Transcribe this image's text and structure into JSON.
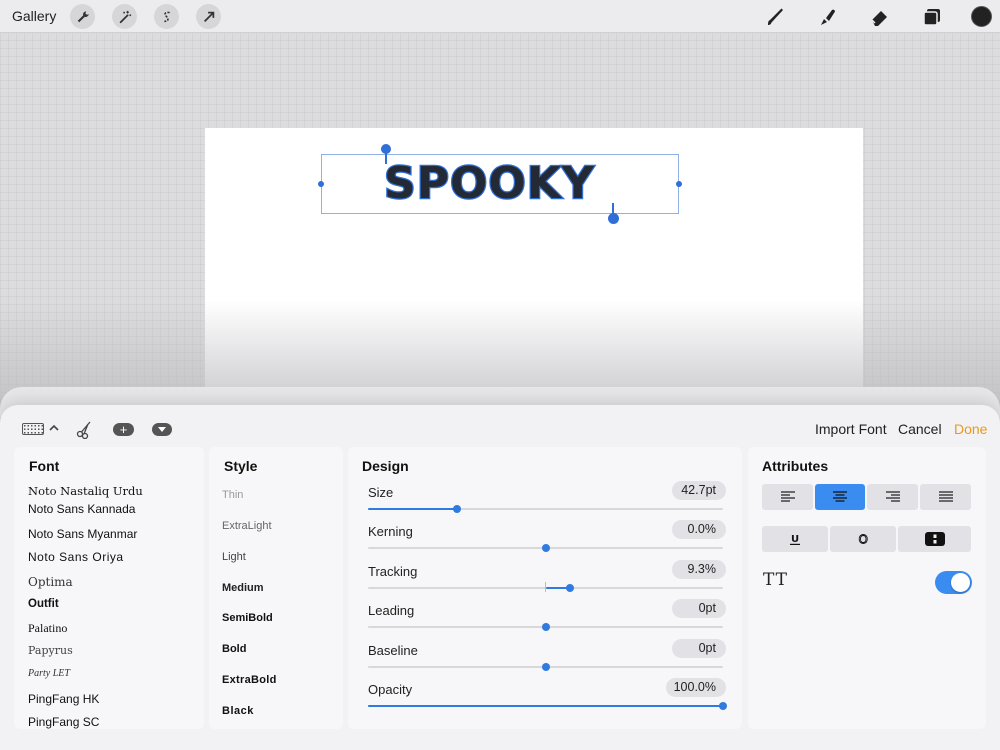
{
  "topbar": {
    "gallery_label": "Gallery",
    "left_tools": [
      "wrench-icon",
      "magic-wand-icon",
      "selection-s-icon",
      "transform-arrow-icon"
    ],
    "right_tools": [
      "brush-icon",
      "smudge-icon",
      "eraser-icon",
      "layers-icon"
    ],
    "active_color": "#222222"
  },
  "canvas": {
    "text": "SPOOKY",
    "text_color": "#232a35",
    "outline_color": "#2f6fd6"
  },
  "panel_toolbar": {
    "import_font": "Import Font",
    "cancel": "Cancel",
    "done": "Done",
    "plus": "+"
  },
  "font_column": {
    "title": "Font",
    "items": [
      "Noto Nastaliq Urdu",
      "Noto Sans Kannada",
      "Noto Sans Myanmar",
      "Noto Sans Oriya",
      "Optima",
      "Outfit",
      "Palatino",
      "Papyrus",
      "Party LET",
      "PingFang HK",
      "PingFang SC"
    ],
    "selected": "Outfit"
  },
  "style_column": {
    "title": "Style",
    "items": [
      "Thin",
      "ExtraLight",
      "Light",
      "Medium",
      "SemiBold",
      "Bold",
      "ExtraBold",
      "Black"
    ]
  },
  "design_column": {
    "title": "Design",
    "rows": [
      {
        "label": "Size",
        "value": "42.7pt",
        "level": 0.25
      },
      {
        "label": "Kerning",
        "value": "0.0%",
        "level": 0.5
      },
      {
        "label": "Tracking",
        "value": "9.3%",
        "level": 0.57
      },
      {
        "label": "Leading",
        "value": "0pt",
        "level": 0.5
      },
      {
        "label": "Baseline",
        "value": "0pt",
        "level": 0.5
      },
      {
        "label": "Opacity",
        "value": "100.0%",
        "level": 1.0
      }
    ]
  },
  "attributes_column": {
    "title": "Attributes",
    "alignment": [
      "align-left-icon",
      "align-center-icon",
      "align-right-icon",
      "align-justify-icon"
    ],
    "active_alignment": "align-center-icon",
    "styles": [
      "underline-icon",
      "outline-icon",
      "style-toggle-icon"
    ],
    "all_caps_label": "TT",
    "all_caps_on": true
  }
}
